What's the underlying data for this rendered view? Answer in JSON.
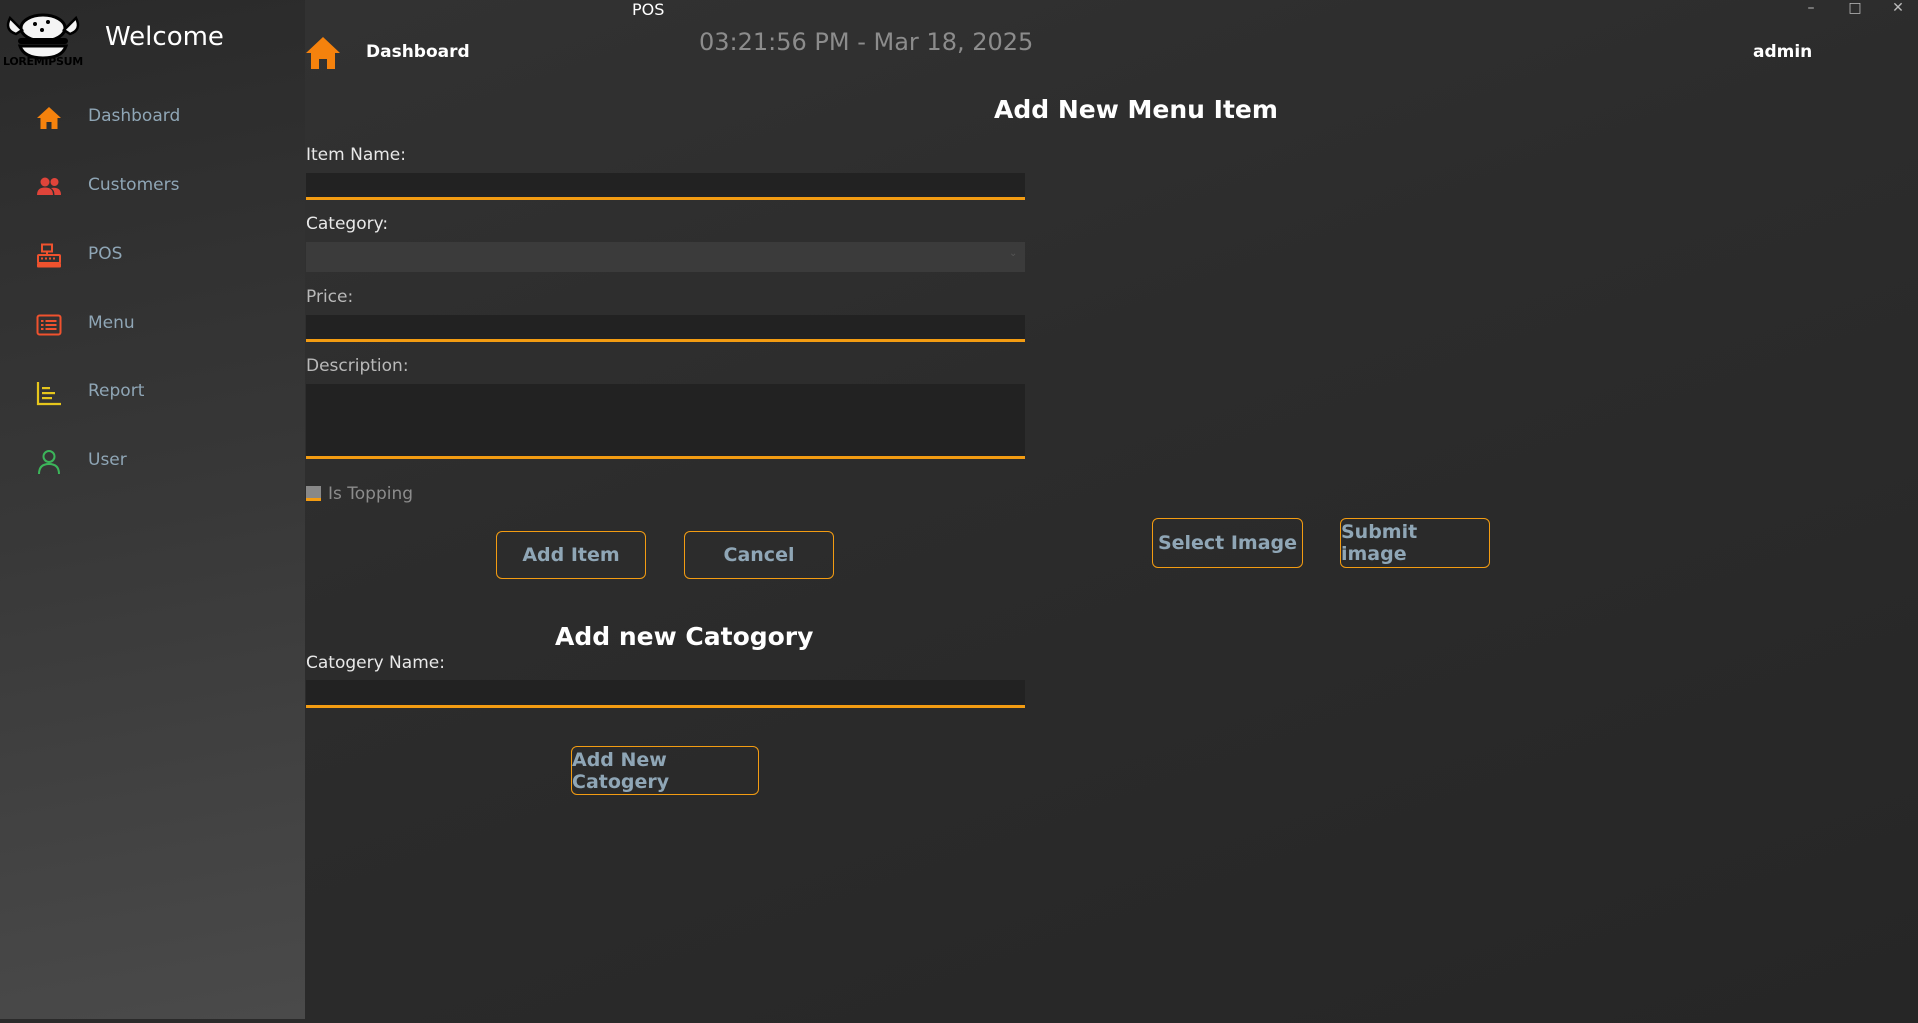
{
  "window": {
    "title": "POS",
    "controls": [
      "–",
      "□",
      "✕"
    ]
  },
  "sidebar": {
    "logo_text": "LOREMIPSUM",
    "welcome": "Welcome",
    "items": [
      {
        "label": "Dashboard",
        "icon": "home-icon",
        "color": "#f5820d"
      },
      {
        "label": "Customers",
        "icon": "customers-icon",
        "color": "#e0443a"
      },
      {
        "label": "POS",
        "icon": "cash-register-icon",
        "color": "#f0522e"
      },
      {
        "label": "Menu",
        "icon": "menu-list-icon",
        "color": "#f0522e"
      },
      {
        "label": "Report",
        "icon": "report-icon",
        "color": "#e6c61c"
      },
      {
        "label": "User",
        "icon": "user-icon",
        "color": "#3cb55a"
      }
    ]
  },
  "header": {
    "breadcrumb": "Dashboard",
    "clock": "03:21:56 PM - Mar 18, 2025",
    "user": "admin"
  },
  "menu_form": {
    "title": "Add New Menu Item",
    "item_name_label": "Item Name:",
    "item_name_value": "",
    "category_label": "Category:",
    "category_value": "",
    "price_label": "Price:",
    "price_value": "",
    "description_label": "Description:",
    "description_value": "",
    "topping_label": "Is Topping",
    "add_button": "Add Item",
    "cancel_button": "Cancel"
  },
  "image_panel": {
    "select_button": "Select Image",
    "submit_button": "Submit image"
  },
  "category_form": {
    "title": "Add new Catogory",
    "name_label": "Catogery Name:",
    "name_value": "",
    "add_button": "Add New Catogery"
  },
  "colors": {
    "accent": "#f39c12",
    "muted_text": "#8fa6b6"
  }
}
